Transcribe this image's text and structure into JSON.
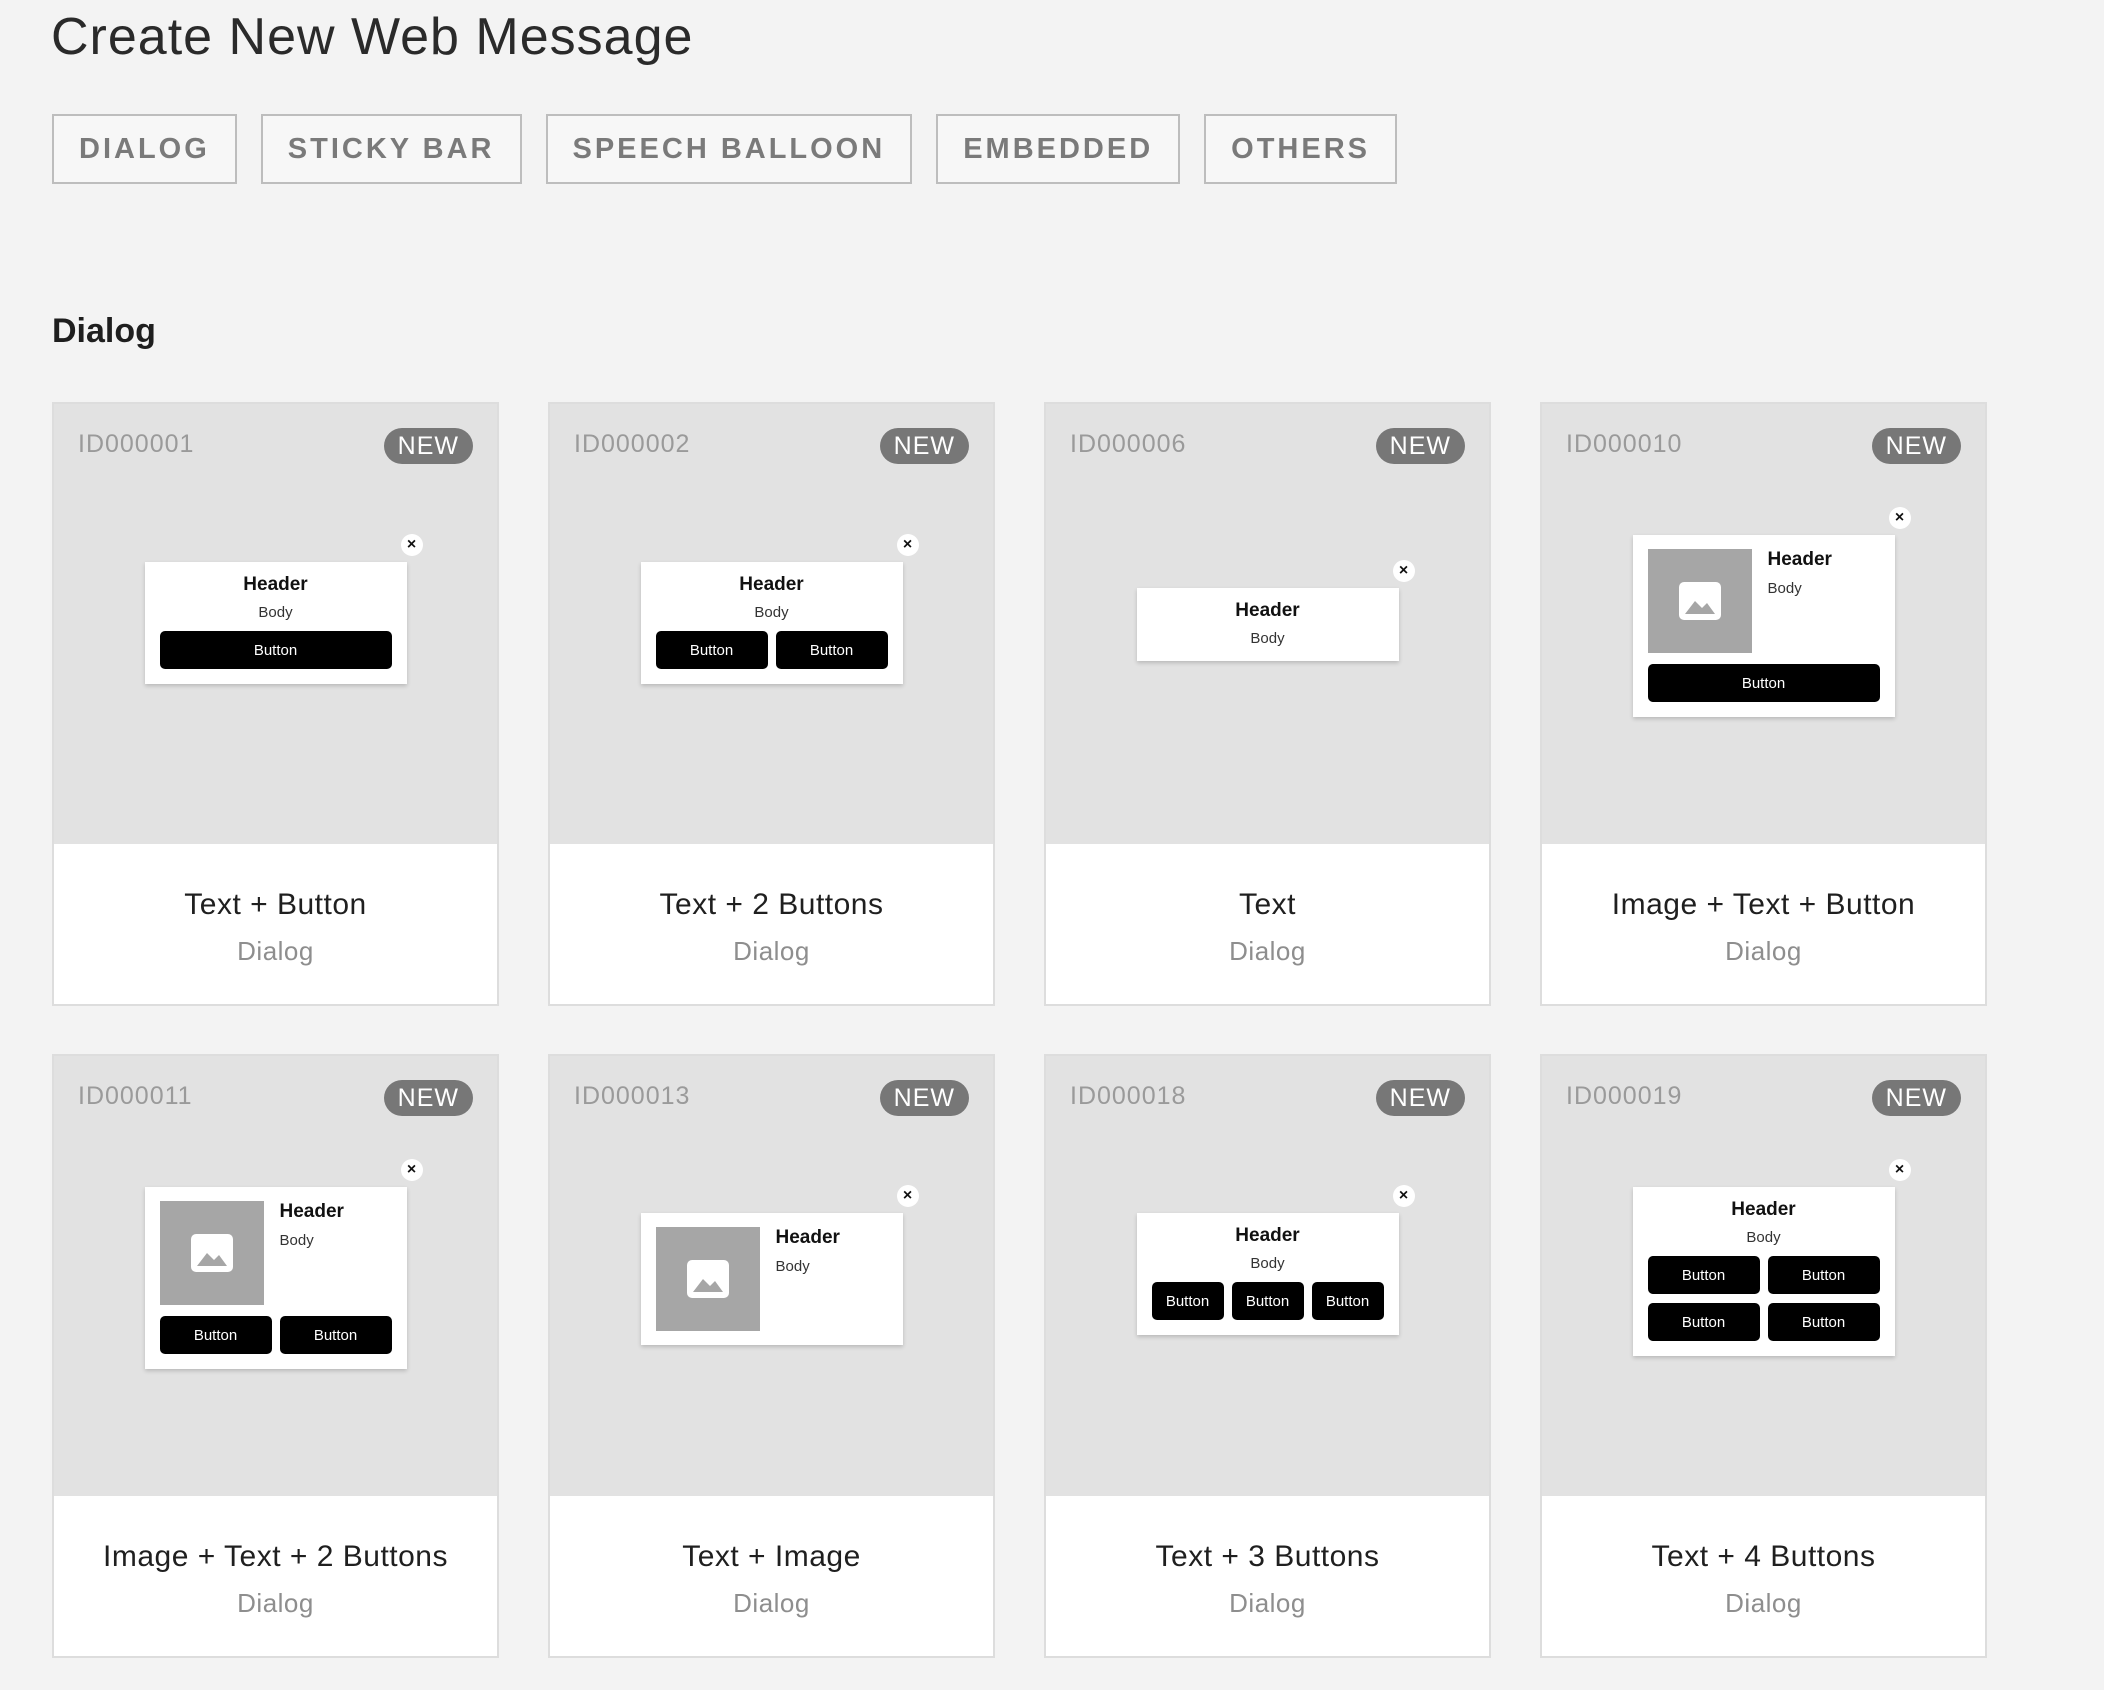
{
  "page": {
    "title": "Create New Web Message"
  },
  "filters": [
    "DIALOG",
    "STICKY BAR",
    "SPEECH BALLOON",
    "EMBEDDED",
    "OTHERS"
  ],
  "section": {
    "title": "Dialog"
  },
  "mock": {
    "header": "Header",
    "body": "Body",
    "button": "Button",
    "close": "×"
  },
  "cards": [
    {
      "id": "ID000001",
      "badge": "NEW",
      "title": "Text + Button",
      "subtitle": "Dialog"
    },
    {
      "id": "ID000002",
      "badge": "NEW",
      "title": "Text + 2 Buttons",
      "subtitle": "Dialog"
    },
    {
      "id": "ID000006",
      "badge": "NEW",
      "title": "Text",
      "subtitle": "Dialog"
    },
    {
      "id": "ID000010",
      "badge": "NEW",
      "title": "Image + Text + Button",
      "subtitle": "Dialog"
    },
    {
      "id": "ID000011",
      "badge": "NEW",
      "title": "Image + Text + 2 Buttons",
      "subtitle": "Dialog"
    },
    {
      "id": "ID000013",
      "badge": "NEW",
      "title": "Text + Image",
      "subtitle": "Dialog"
    },
    {
      "id": "ID000018",
      "badge": "NEW",
      "title": "Text + 3 Buttons",
      "subtitle": "Dialog"
    },
    {
      "id": "ID000019",
      "badge": "NEW",
      "title": "Text + 4 Buttons",
      "subtitle": "Dialog"
    }
  ],
  "icons": {
    "close": "close-icon",
    "image": "image-icon"
  },
  "colors": {
    "badge": "#777777",
    "button": "#000000",
    "placeholder": "#a6a6a6"
  }
}
